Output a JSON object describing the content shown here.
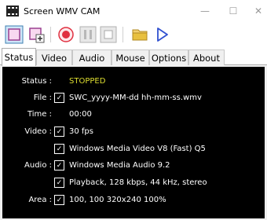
{
  "window": {
    "title": "Screen WMV CAM",
    "minimize_glyph": "—",
    "maximize_glyph": "☐",
    "close_glyph": "✕"
  },
  "toolbar": {
    "icons": [
      "select-region-icon",
      "add-region-icon",
      "record-icon",
      "pause-icon",
      "stop-icon",
      "open-folder-icon",
      "play-icon"
    ]
  },
  "tabs": [
    {
      "label": "Status",
      "active": true
    },
    {
      "label": "Video",
      "active": false
    },
    {
      "label": "Audio",
      "active": false
    },
    {
      "label": "Mouse",
      "active": false
    },
    {
      "label": "Options",
      "active": false
    },
    {
      "label": "About",
      "active": false
    }
  ],
  "status": {
    "status_label": "Status :",
    "status_value": "STOPPED",
    "file_label": "File :",
    "file_value": "SWC_yyyy-MM-dd hh-mm-ss.wmv",
    "time_label": "Time :",
    "time_value": "00:00",
    "video_label": "Video :",
    "video_fps": "30 fps",
    "video_codec": "Windows Media Video V8 (Fast) Q5",
    "audio_label": "Audio :",
    "audio_codec": "Windows Media Audio 9.2",
    "audio_format": "Playback, 128 kbps, 44 kHz, stereo",
    "area_label": "Area :",
    "area_value": "100, 100  320x240 100%",
    "check_glyph": "✓"
  },
  "colors": {
    "status_value": "#dede30",
    "record": "#e03040",
    "play": "#3050d0",
    "folder": "#e8c040"
  }
}
